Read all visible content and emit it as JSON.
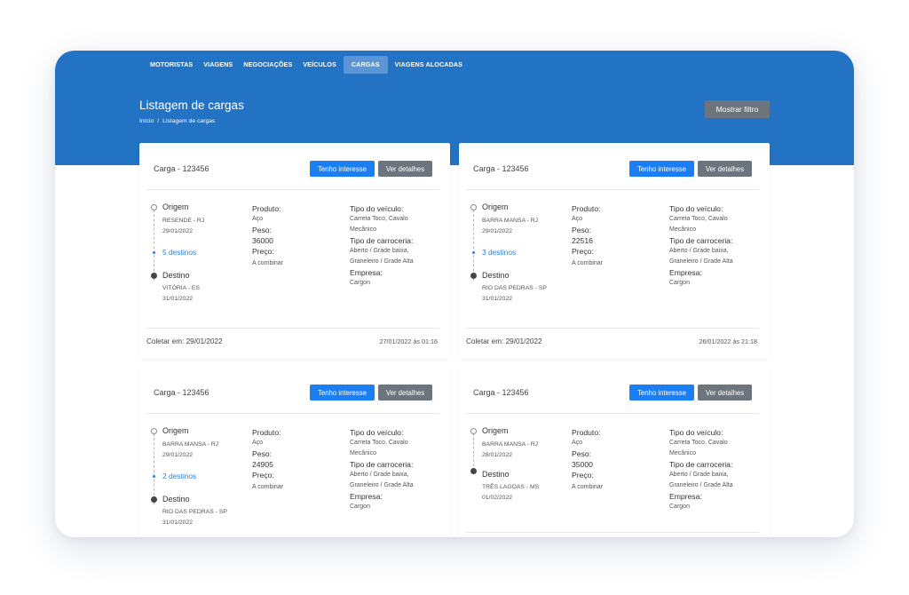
{
  "nav": {
    "items": [
      "MOTORISTAS",
      "VIAGENS",
      "NEGOCIAÇÕES",
      "VEÍCULOS",
      "CARGAS",
      "VIAGENS ALOCADAS"
    ],
    "active": "CARGAS"
  },
  "header": {
    "title": "Listagem de cargas",
    "breadcrumb": [
      "Início",
      "/",
      "Listagem de cargas"
    ],
    "filter_button": "Mostrar filtro"
  },
  "labels": {
    "interest": "Tenho interesse",
    "details": "Ver detalhes",
    "origin": "Origem",
    "destination": "Destino",
    "product": "Produto:",
    "weight": "Peso:",
    "price": "Preço:",
    "vehicle_type": "Tipo do veículo:",
    "body_type": "Tipo de carroceria:",
    "company": "Empresa:"
  },
  "colors": {
    "header_blue": "#2273c4",
    "interest_blue": "#1a7ef5",
    "details_gray": "#6c757d",
    "link_blue": "#2f7fd6"
  },
  "cards": [
    {
      "title": "Carga - 123456",
      "origin_city": "RESENDE - RJ",
      "origin_date": "29/01/2022",
      "destinations": "5 destinos",
      "dest_city": "VITÓRIA - ES",
      "dest_date": "31/01/2022",
      "product": "Aço",
      "weight": "36000",
      "price": "A combinar",
      "vehicle_type_1": "Carreta Toco, Cavalo",
      "vehicle_type_2": "Mecânico",
      "body_type_1": "Aberto / Grade baixa,",
      "body_type_2": "Graneleiro / Grade Alta",
      "company": "Cargon",
      "collect": "Coletar em: 29/01/2022",
      "posted": "27/01/2022 às 01:16"
    },
    {
      "title": "Carga - 123456",
      "origin_city": "BARRA MANSA - RJ",
      "origin_date": "29/01/2022",
      "destinations": "3 destinos",
      "dest_city": "RIO DAS PEDRAS - SP",
      "dest_date": "31/01/2022",
      "product": "Aço",
      "weight": "22516",
      "price": "A combinar",
      "vehicle_type_1": "Carreta Toco, Cavalo",
      "vehicle_type_2": "Mecânico",
      "body_type_1": "Aberto / Grade baixa,",
      "body_type_2": "Graneleiro / Grade Alta",
      "company": "Cargon",
      "collect": "Coletar em: 29/01/2022",
      "posted": "26/01/2022 às 21:18"
    },
    {
      "title": "Carga - 123456",
      "origin_city": "BARRA MANSA - RJ",
      "origin_date": "29/01/2022",
      "destinations": "2 destinos",
      "dest_city": "RIO DAS PEDRAS - SP",
      "dest_date": "31/01/2022",
      "product": "Aço",
      "weight": "24905",
      "price": "A combinar",
      "vehicle_type_1": "Carreta Toco, Cavalo",
      "vehicle_type_2": "Mecânico",
      "body_type_1": "Aberto / Grade baixa,",
      "body_type_2": "Graneleiro / Grade Alta",
      "company": "Cargon"
    },
    {
      "title": "Carga - 123456",
      "origin_city": "BARRA MANSA - RJ",
      "origin_date": "28/01/2022",
      "dest_city": "TRÊS LAGOAS - MS",
      "dest_date": "01/02/2022",
      "product": "Aço",
      "weight": "35000",
      "price": "A combinar",
      "vehicle_type_1": "Carreta Toco, Cavalo",
      "vehicle_type_2": "Mecânico",
      "body_type_1": "Aberto / Grade baixa,",
      "body_type_2": "Graneleiro / Grade Alta",
      "company": "Cargon"
    }
  ]
}
